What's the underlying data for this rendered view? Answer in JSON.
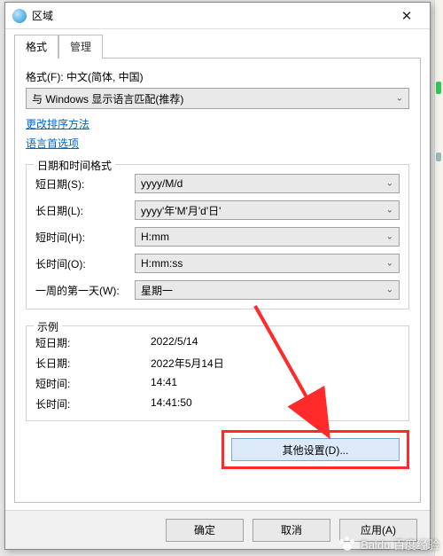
{
  "window": {
    "title": "区域",
    "close_glyph": "✕"
  },
  "tabs": {
    "format": "格式",
    "admin": "管理"
  },
  "format_section": {
    "label": "格式(F): 中文(简体, 中国)",
    "select_value": "与 Windows 显示语言匹配(推荐)",
    "link_sort": "更改排序方法",
    "link_lang": "语言首选项"
  },
  "datetime_group": {
    "title": "日期和时间格式",
    "rows": {
      "short_date": {
        "label": "短日期(S):",
        "value": "yyyy/M/d"
      },
      "long_date": {
        "label": "长日期(L):",
        "value": "yyyy'年'M'月'd'日'"
      },
      "short_time": {
        "label": "短时间(H):",
        "value": "H:mm"
      },
      "long_time": {
        "label": "长时间(O):",
        "value": "H:mm:ss"
      },
      "first_day": {
        "label": "一周的第一天(W):",
        "value": "星期一"
      }
    }
  },
  "example_group": {
    "title": "示例",
    "rows": {
      "short_date": {
        "label": "短日期:",
        "value": "2022/5/14"
      },
      "long_date": {
        "label": "长日期:",
        "value": "2022年5月14日"
      },
      "short_time": {
        "label": "短时间:",
        "value": "14:41"
      },
      "long_time": {
        "label": "长时间:",
        "value": "14:41:50"
      }
    }
  },
  "buttons": {
    "other": "其他设置(D)...",
    "ok": "确定",
    "cancel": "取消",
    "apply": "应用(A)"
  },
  "watermark": "Baidu 百度经验",
  "dropdown_glyph": "⌄"
}
